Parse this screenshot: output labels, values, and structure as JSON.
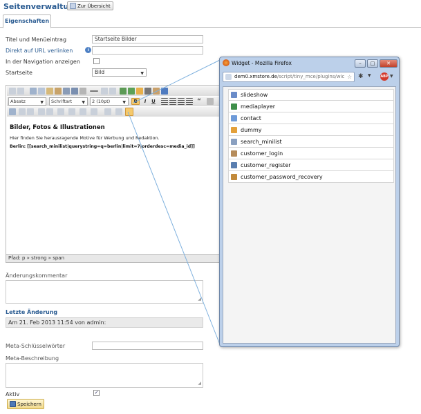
{
  "page": {
    "title": "Seitenverwaltung",
    "overview_button": "Zur Übersicht",
    "tab": "Eigenschaften"
  },
  "form": {
    "title_label": "Titel und Menüeintrag",
    "title_value": "Startseite Bilder",
    "url_link_label": "Direkt auf URL verlinken",
    "url_value": "",
    "nav_label": "In der Navigation anzeigen",
    "nav_checked": false,
    "startpage_label": "Startseite",
    "startpage_value": "Bild",
    "change_comment_label": "Änderungskommentar",
    "last_change_heading": "Letzte Änderung",
    "last_change_value": "Am 21. Feb 2013 11:54 von admin:",
    "meta_keywords_label": "Meta-Schlüsselwörter",
    "meta_description_label": "Meta-Beschreibung",
    "active_label": "Aktiv",
    "active_checked": true,
    "save_button": "Speichern"
  },
  "editor": {
    "format_select": "Absatz",
    "font_select": "Schriftart",
    "size_select": "2 (10pt)",
    "bold": "B",
    "italic": "I",
    "underline": "U",
    "quote": "“",
    "heading": "Bilder, Fotos & Illustrationen",
    "paragraph": "Hier finden Sie herausragende Motive für Werbung und Redaktion.",
    "code_line": "Berlin: [[search_minilist|querystring=q=berlin|limit=7|orderdesc=media_id]]",
    "path": "Pfad: p » strong » span"
  },
  "popup": {
    "window_title": "Widget - Mozilla Firefox",
    "url_host": "dem0.xmstore.de",
    "url_path": "/script/tiny_mce/plugins/wic",
    "items": [
      {
        "label": "slideshow",
        "icon": "slideshow-icon",
        "color": "#6a8cc9"
      },
      {
        "label": "mediaplayer",
        "icon": "film-icon",
        "color": "#3f8f4a"
      },
      {
        "label": "contact",
        "icon": "envelope-icon",
        "color": "#6d9ad8"
      },
      {
        "label": "dummy",
        "icon": "person-icon",
        "color": "#e3a03a"
      },
      {
        "label": "search_minilist",
        "icon": "magnifier-icon",
        "color": "#8aa0c0"
      },
      {
        "label": "customer_login",
        "icon": "door-icon",
        "color": "#b58b5a"
      },
      {
        "label": "customer_register",
        "icon": "user-add-icon",
        "color": "#5a7fb0"
      },
      {
        "label": "customer_password_recovery",
        "icon": "user-key-icon",
        "color": "#c28a3b"
      }
    ]
  },
  "colors": {
    "accent": "#2b5c92",
    "highlight_button": "#f5c96b"
  }
}
